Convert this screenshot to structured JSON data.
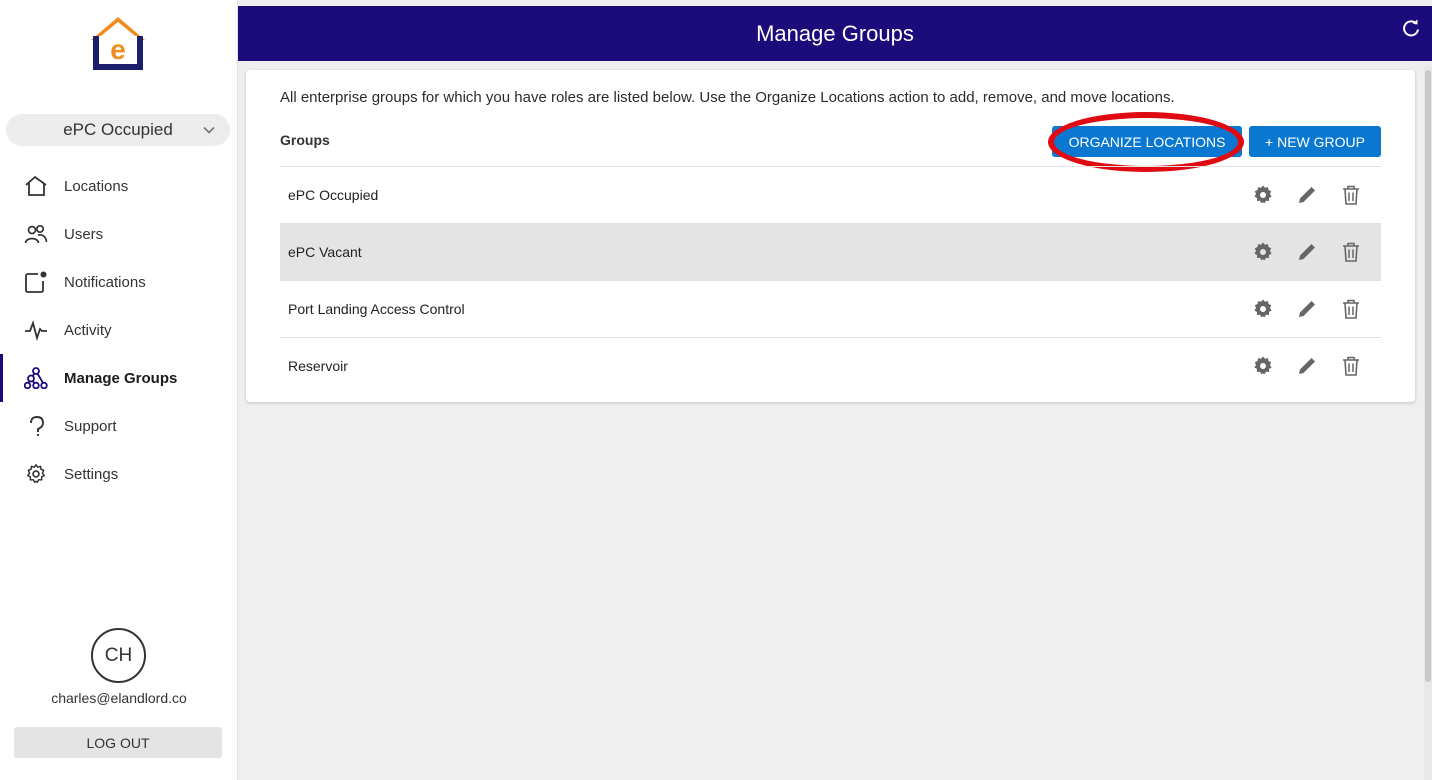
{
  "header": {
    "title": "Manage Groups",
    "refresh_icon": "refresh-icon"
  },
  "sidebar": {
    "logo": "elandlord-logo",
    "selector": {
      "value": "ePC Occupied"
    },
    "items": [
      {
        "label": "Locations",
        "icon": "house-icon"
      },
      {
        "label": "Users",
        "icon": "users-icon"
      },
      {
        "label": "Notifications",
        "icon": "notification-icon"
      },
      {
        "label": "Activity",
        "icon": "activity-icon"
      },
      {
        "label": "Manage Groups",
        "icon": "hierarchy-icon",
        "active": true
      },
      {
        "label": "Support",
        "icon": "support-icon"
      },
      {
        "label": "Settings",
        "icon": "gear-icon"
      }
    ],
    "user": {
      "initials": "CH",
      "email": "charles@elandlord.co"
    },
    "logout_label": "LOG OUT"
  },
  "main": {
    "description": "All enterprise groups for which you have roles are listed below. Use the Organize Locations action to add, remove, and move locations.",
    "groups_label": "Groups",
    "organize_button": "ORGANIZE LOCATIONS",
    "new_group_button": "+ NEW GROUP",
    "groups": [
      {
        "name": "ePC Occupied"
      },
      {
        "name": "ePC Vacant",
        "highlighted": true
      },
      {
        "name": "Port Landing Access Control"
      },
      {
        "name": "Reservoir"
      }
    ]
  },
  "colors": {
    "header": "#1b0b7b",
    "primary_button": "#0a78d0",
    "highlight_ring": "#e00a12",
    "logo_orange": "#f08c1e"
  }
}
